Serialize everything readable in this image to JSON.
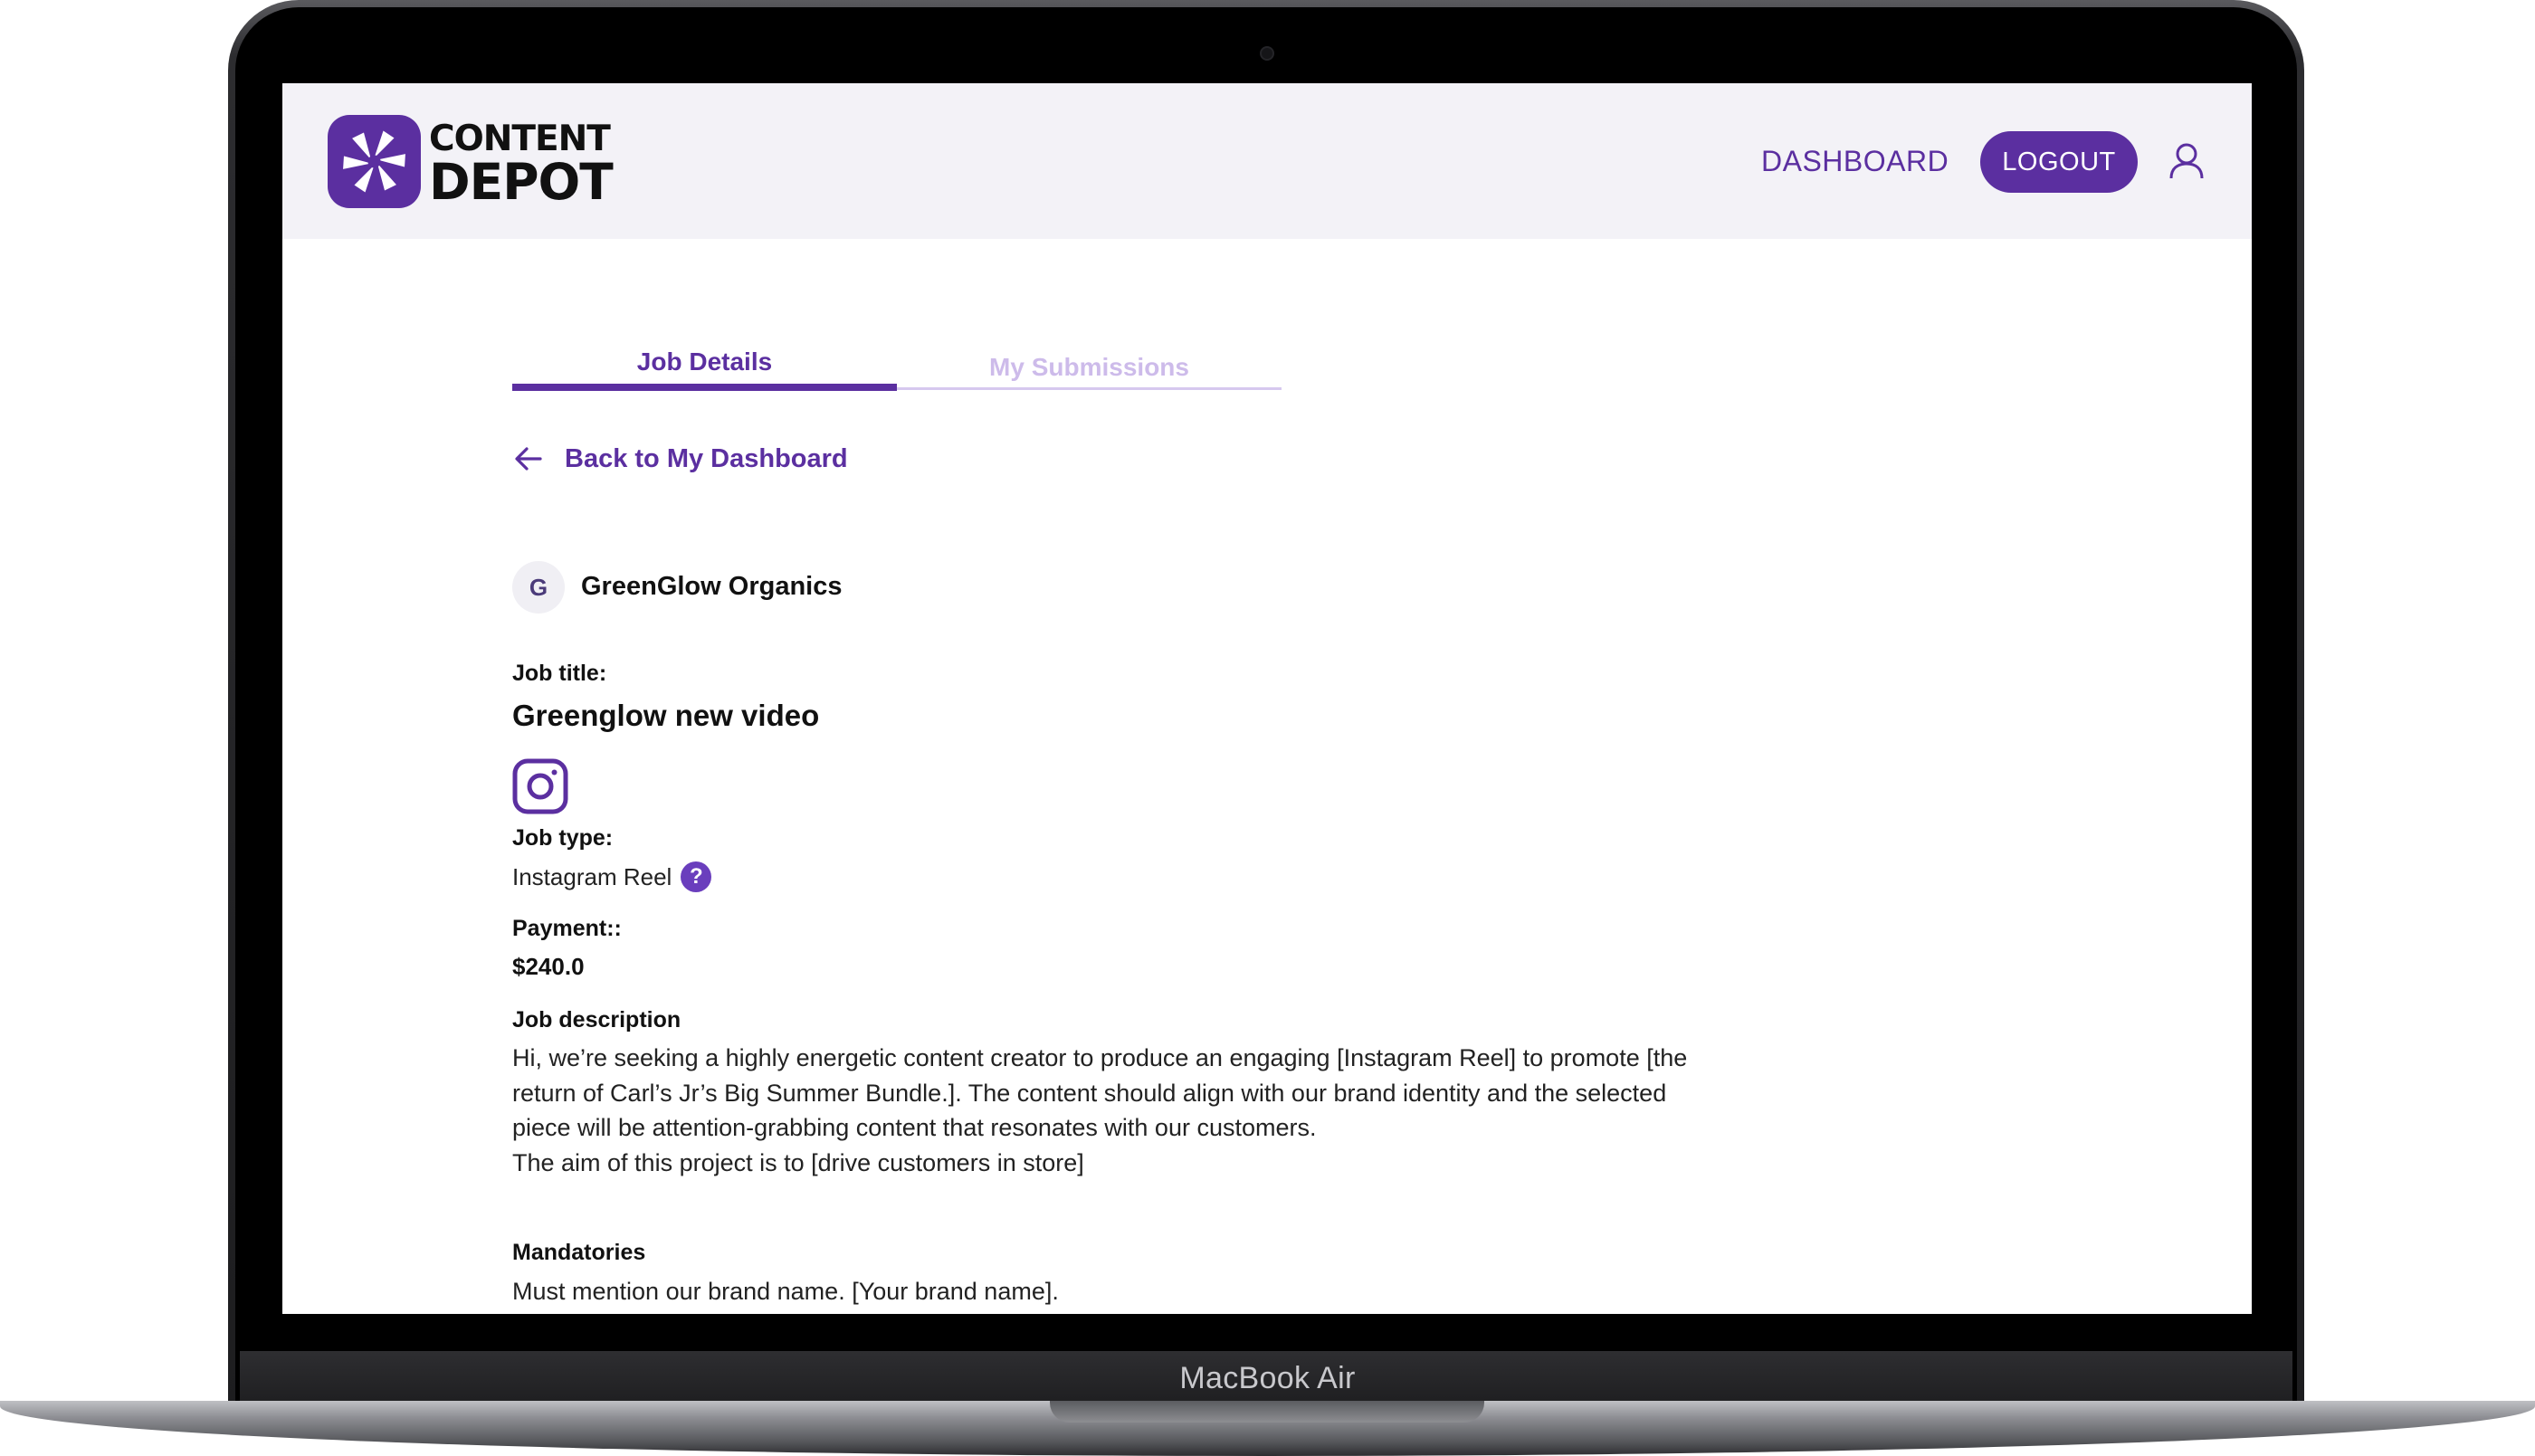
{
  "device": {
    "label": "MacBook Air"
  },
  "brand": {
    "line1": "CONTENT",
    "line2": "DEPOT",
    "color": "#5b2fa0"
  },
  "header": {
    "nav_dashboard": "DASHBOARD",
    "logout_label": "LOGOUT",
    "user_icon": "user-icon"
  },
  "tabs": [
    {
      "label": "Job Details",
      "active": true
    },
    {
      "label": "My Submissions",
      "active": false
    }
  ],
  "back_link": {
    "label": "Back to My Dashboard",
    "icon": "arrow-left-icon"
  },
  "company": {
    "initial": "G",
    "name": "GreenGlow Organics"
  },
  "job": {
    "title_label": "Job title:",
    "title": "Greenglow new video",
    "platform_icon": "instagram-icon",
    "type_label": "Job type:",
    "type": "Instagram Reel",
    "help_glyph": "?",
    "payment_label": "Payment::",
    "payment": "$240.0",
    "description_label": "Job description",
    "description_1": "Hi, we’re seeking a highly energetic content creator to produce an engaging [Instagram Reel] to promote [the return of Carl’s Jr’s Big Summer Bundle.]. The content should align with our brand identity and the selected piece will be attention-grabbing content that resonates with our customers.",
    "description_2": "The aim of this project is to [drive customers in store]",
    "mandatories_label": "Mandatories",
    "mandatories": "Must mention our brand name. [Your brand name]."
  }
}
